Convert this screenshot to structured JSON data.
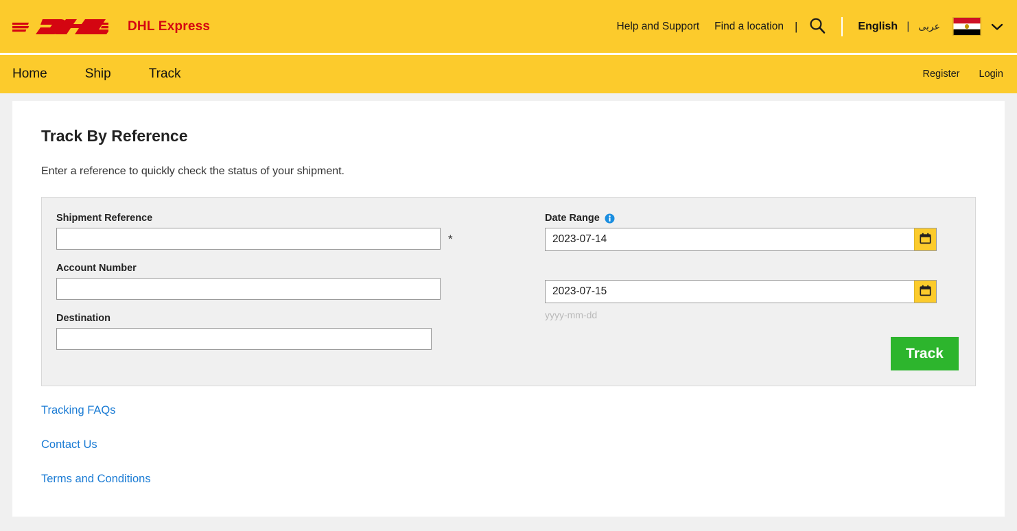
{
  "header": {
    "brand_name": "DHL Express",
    "logo_icon": "dhl-logo",
    "help_link": "Help and Support",
    "location_link": "Find a location",
    "pipe": "|",
    "search_icon": "search-icon",
    "language_active": "English",
    "language_divider": "|",
    "language_arabic": "عربى",
    "flag_icon": "egypt-flag-icon",
    "chevron_icon": "chevron-down-icon"
  },
  "nav": {
    "items": [
      {
        "label": "Home"
      },
      {
        "label": "Ship"
      },
      {
        "label": "Track"
      }
    ],
    "register": "Register",
    "login": "Login"
  },
  "main": {
    "title": "Track By Reference",
    "subtitle": "Enter a reference to quickly check the status of your shipment."
  },
  "form": {
    "shipment_reference": {
      "label": "Shipment Reference",
      "value": "",
      "placeholder": "",
      "required_mark": "*"
    },
    "account_number": {
      "label": "Account Number",
      "value": "",
      "placeholder": ""
    },
    "destination": {
      "label": "Destination",
      "value": "",
      "placeholder": ""
    },
    "date_range": {
      "label": "Date Range",
      "info_icon": "info-icon",
      "from_value": "2023-07-14",
      "to_value": "2023-07-15",
      "from_placeholder": "yyyy-mm-dd",
      "to_placeholder": "yyyy-mm-dd",
      "hint": "yyyy-mm-dd",
      "calendar_icon": "calendar-icon"
    },
    "track_button": "Track"
  },
  "links": [
    {
      "label": "Tracking FAQs"
    },
    {
      "label": "Contact Us"
    },
    {
      "label": "Terms and Conditions"
    }
  ],
  "colors": {
    "brand_yellow": "#fccb2c",
    "brand_red": "#d40511",
    "track_green": "#2db52d",
    "link_blue": "#1a7bd4",
    "info_blue": "#1b8ee0"
  }
}
